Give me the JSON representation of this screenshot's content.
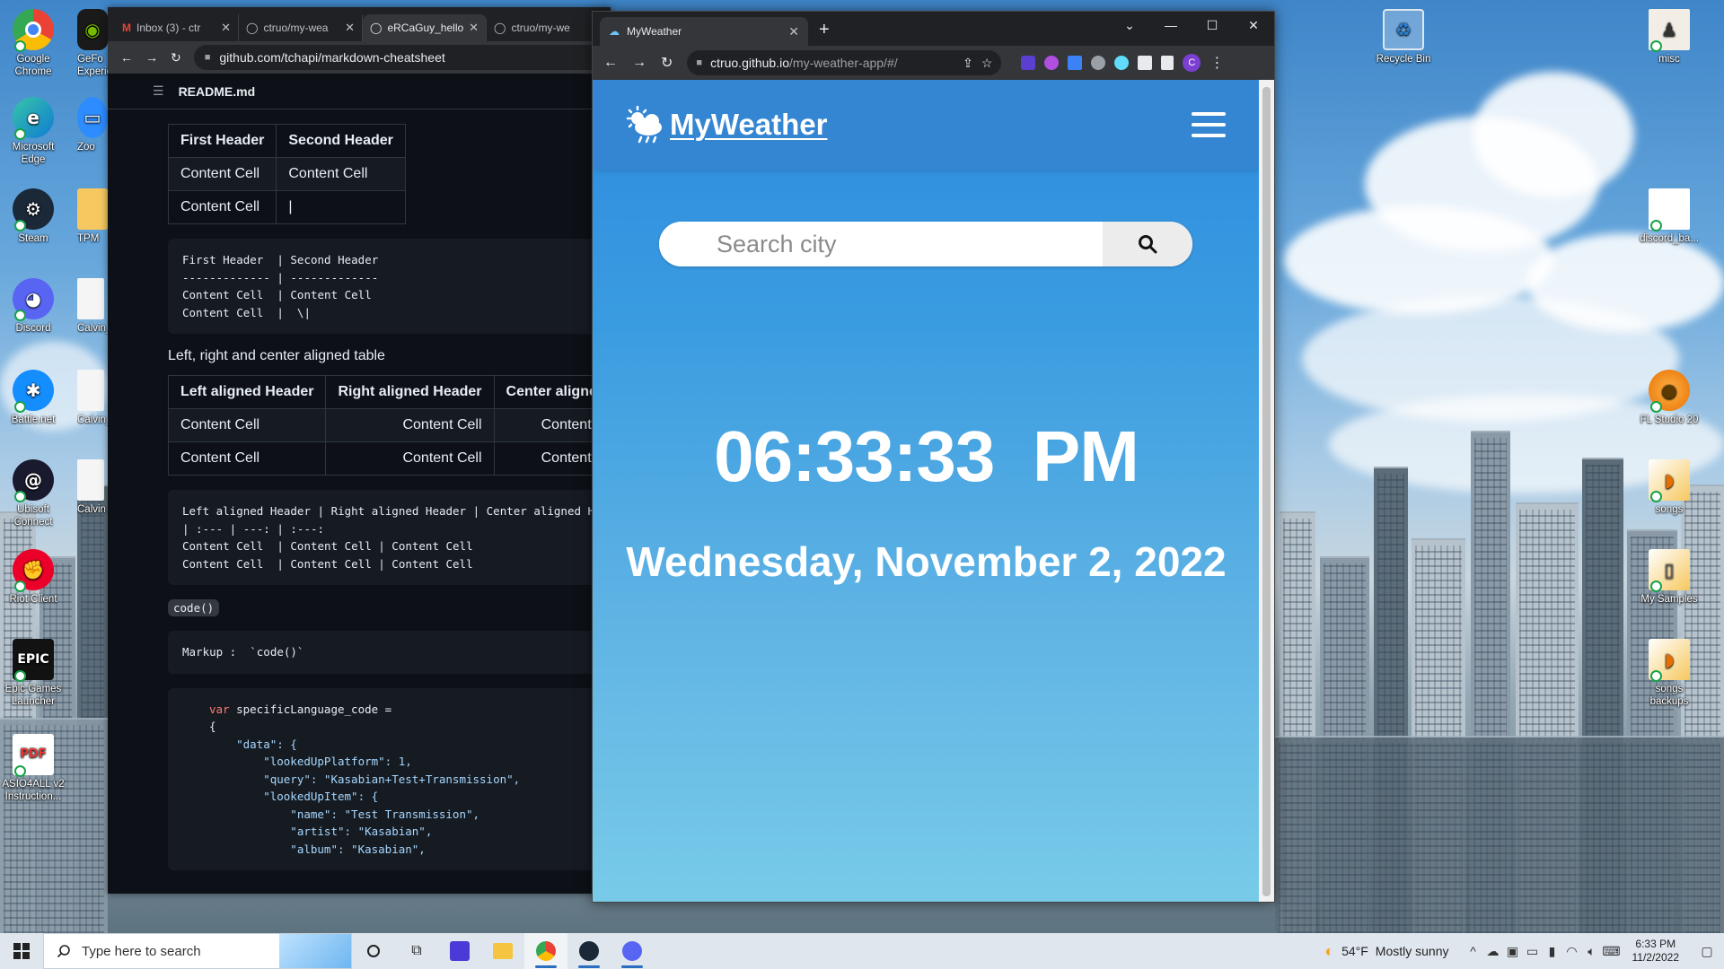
{
  "desktop": {
    "left_icons": [
      {
        "label": "Google Chrome",
        "color": "#ea4335"
      },
      {
        "label": "Microsoft Edge",
        "color": "#0f7bd4"
      },
      {
        "label": "Steam",
        "color": "#1b2838"
      },
      {
        "label": "Discord",
        "color": "#5865f2"
      },
      {
        "label": "Battle.net",
        "color": "#148eff"
      },
      {
        "label": "Ubisoft Connect",
        "color": "#1a1a2e"
      },
      {
        "label": "Riot Client",
        "color": "#eb0029"
      },
      {
        "label": "Epic Games Launcher",
        "color": "#121212"
      },
      {
        "label": "ASIO4ALL v2 Instruction...",
        "color": "#e53935"
      }
    ],
    "partial_icons": [
      "GeFo Experie",
      "Zoo",
      "TPM",
      "Calvin_T",
      "Calvin_",
      "Calvin"
    ],
    "right_icons": [
      {
        "label": "Recycle Bin"
      },
      {
        "label": "misc"
      },
      {
        "label": "discord_ba..."
      },
      {
        "label": "FL Studio 20"
      },
      {
        "label": "songs"
      },
      {
        "label": "My Samples"
      },
      {
        "label": "songs backups"
      }
    ]
  },
  "github_window": {
    "tabs": [
      "Inbox (3) - ctr",
      "ctruo/my-wea",
      "eRCaGuy_hello",
      "ctruo/my-we"
    ],
    "url": "github.com/tchapi/markdown-cheatsheet",
    "file_title": "README.md",
    "table1": {
      "headers": [
        "First Header",
        "Second Header"
      ],
      "rows": [
        [
          "Content Cell",
          "Content Cell"
        ],
        [
          "Content Cell",
          "|"
        ]
      ]
    },
    "code1": "First Header  | Second Header\n------------- | -------------\nContent Cell  | Content Cell\nContent Cell  |  \\|",
    "para1": "Left, right and center aligned table",
    "table2": {
      "headers": [
        "Left aligned Header",
        "Right aligned Header",
        "Center aligned"
      ],
      "rows": [
        [
          "Content Cell",
          "Content Cell",
          "Content C"
        ],
        [
          "Content Cell",
          "Content Cell",
          "Content C"
        ]
      ]
    },
    "code2": "Left aligned Header | Right aligned Header | Center aligned H\n| :--- | ---: | :---:\nContent Cell  | Content Cell | Content Cell\nContent Cell  | Content Cell | Content Cell",
    "inline_code": "code()",
    "code3": "Markup :  `code()`",
    "code4": {
      "line1_kw": "var",
      "line1_rest": " specificLanguage_code =",
      "lines": [
        "{",
        "    \"data\": {",
        "        \"lookedUpPlatform\": 1,",
        "        \"query\": \"Kasabian+Test+Transmission\",",
        "        \"lookedUpItem\": {",
        "            \"name\": \"Test Transmission\",",
        "            \"artist\": \"Kasabian\",",
        "            \"album\": \"Kasabian\","
      ]
    }
  },
  "weather_window": {
    "tab_title": "MyWeather",
    "url_host": "ctruo.github.io",
    "url_path": "/my-weather-app/#/",
    "profile_initial": "C",
    "app": {
      "brand": "MyWeather",
      "search_placeholder": "Search city",
      "time": "06:33:33  PM",
      "date": "Wednesday, November 2, 2022"
    }
  },
  "taskbar": {
    "search_placeholder": "Type here to search",
    "weather_temp": "54°F",
    "weather_desc": "Mostly sunny",
    "time": "6:33 PM",
    "date": "11/2/2022"
  },
  "colors": {
    "app_header": "#3486d3",
    "app_bg_top": "#2e8be0",
    "app_bg_bottom": "#78cbe8",
    "github_bg": "#0d1117",
    "chrome_dark": "#202124"
  }
}
